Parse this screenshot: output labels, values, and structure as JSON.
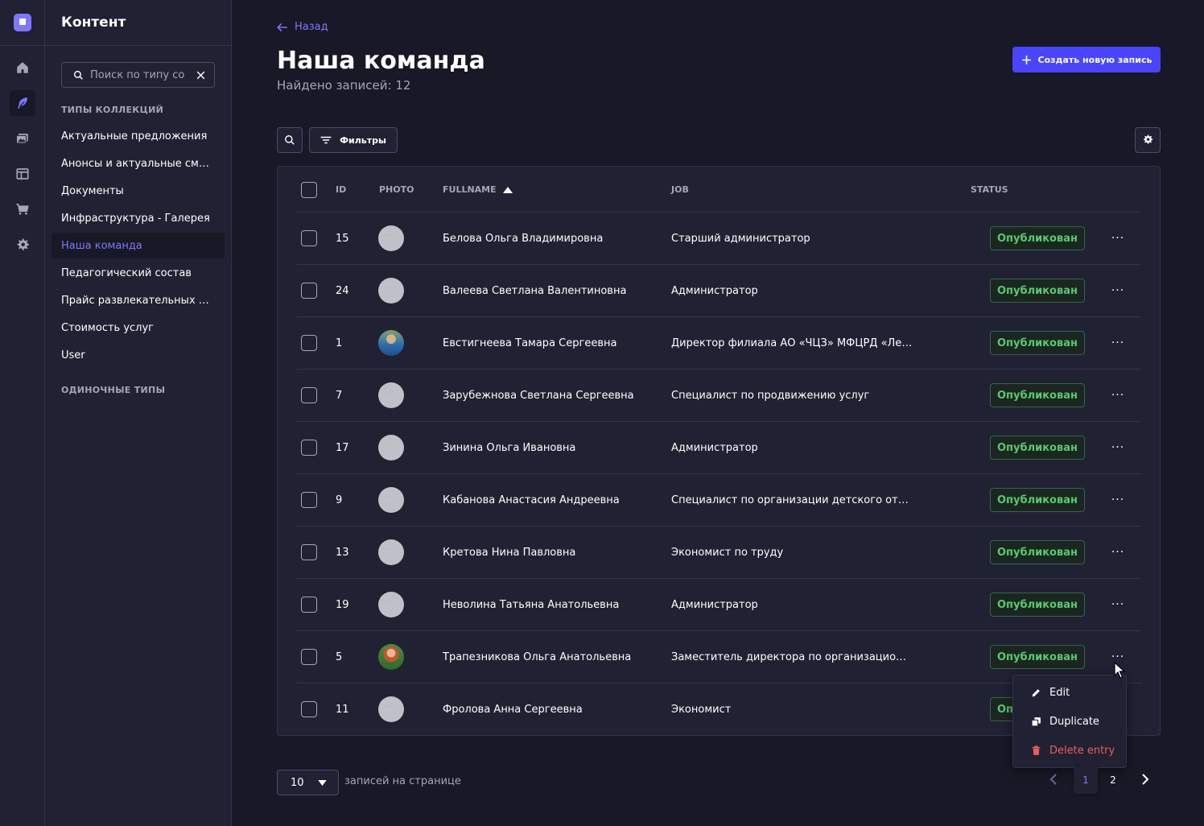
{
  "sidebar": {
    "title": "Контент",
    "search_placeholder": "Поиск по типу со",
    "collection_types_label": "ТИПЫ КОЛЛЕКЦИЙ",
    "single_types_label": "ОДИНОЧНЫЕ ТИПЫ",
    "items": [
      {
        "label": "Актуальные предложения"
      },
      {
        "label": "Анонсы и актуальные смены"
      },
      {
        "label": "Документы"
      },
      {
        "label": "Инфраструктура - Галерея"
      },
      {
        "label": "Наша команда",
        "active": true
      },
      {
        "label": "Педагогический состав"
      },
      {
        "label": "Прайс развлекательных п..."
      },
      {
        "label": "Стоимость услуг"
      },
      {
        "label": "User"
      }
    ]
  },
  "rail": {
    "icons": [
      "home-icon",
      "feather-icon",
      "media-library-icon",
      "layout-icon",
      "cart-icon",
      "gear-icon"
    ]
  },
  "header": {
    "back_label": "Назад",
    "title": "Наша команда",
    "subtitle": "Найдено записей: 12",
    "create_label": "Создать новую запись"
  },
  "toolbar": {
    "filters_label": "Фильтры"
  },
  "table": {
    "columns": {
      "id": "ID",
      "photo": "PHOTO",
      "fullname": "FULLNAME",
      "job": "JOB",
      "status": "STATUS"
    },
    "sort": {
      "column": "fullname",
      "direction": "asc"
    },
    "rows": [
      {
        "id": "15",
        "name": "Белова Ольга Владимировна",
        "job": "Старший администратор",
        "status": "Опубликован",
        "photo": "placeholder"
      },
      {
        "id": "24",
        "name": "Валеева Светлана Валентиновна",
        "job": "Администратор",
        "status": "Опубликован",
        "photo": "placeholder"
      },
      {
        "id": "1",
        "name": "Евстигнеева Тамара Сергеевна",
        "job": "Директор филиала АО «ЧЦЗ» МФЦРД «Лес...",
        "status": "Опубликован",
        "photo": "photo1"
      },
      {
        "id": "7",
        "name": "Зарубежнова Светлана Сергеевна",
        "job": "Специалист по продвижению услуг",
        "status": "Опубликован",
        "photo": "placeholder"
      },
      {
        "id": "17",
        "name": "Зинина Ольга Ивановна",
        "job": "Администратор",
        "status": "Опубликован",
        "photo": "placeholder"
      },
      {
        "id": "9",
        "name": "Кабанова Анастасия Андреевна",
        "job": "Специалист по организации детского отдыха",
        "status": "Опубликован",
        "photo": "placeholder"
      },
      {
        "id": "13",
        "name": "Кретова Нина Павловна",
        "job": "Экономист по труду",
        "status": "Опубликован",
        "photo": "placeholder"
      },
      {
        "id": "19",
        "name": "Неволина Татьяна Анатольевна",
        "job": "Администратор",
        "status": "Опубликован",
        "photo": "placeholder"
      },
      {
        "id": "5",
        "name": "Трапезникова Ольга Анатольевна",
        "job": "Заместитель директора по организационны...",
        "status": "Опубликован",
        "photo": "photo2"
      },
      {
        "id": "11",
        "name": "Фролова Анна Сергеевна",
        "job": "Экономист",
        "status": "Опубликован",
        "photo": "placeholder"
      }
    ]
  },
  "context_menu": {
    "edit": "Edit",
    "duplicate": "Duplicate",
    "delete": "Delete entry"
  },
  "pagination": {
    "page_size": "10",
    "page_size_label": "записей на странице",
    "pages": [
      "1",
      "2"
    ],
    "current_page": "1"
  },
  "colors": {
    "accent": "#7b79ff",
    "primary_button": "#4945ff",
    "published": "#55cb6d",
    "danger": "#ee5e52",
    "background": "#181826",
    "panel": "#212134"
  }
}
